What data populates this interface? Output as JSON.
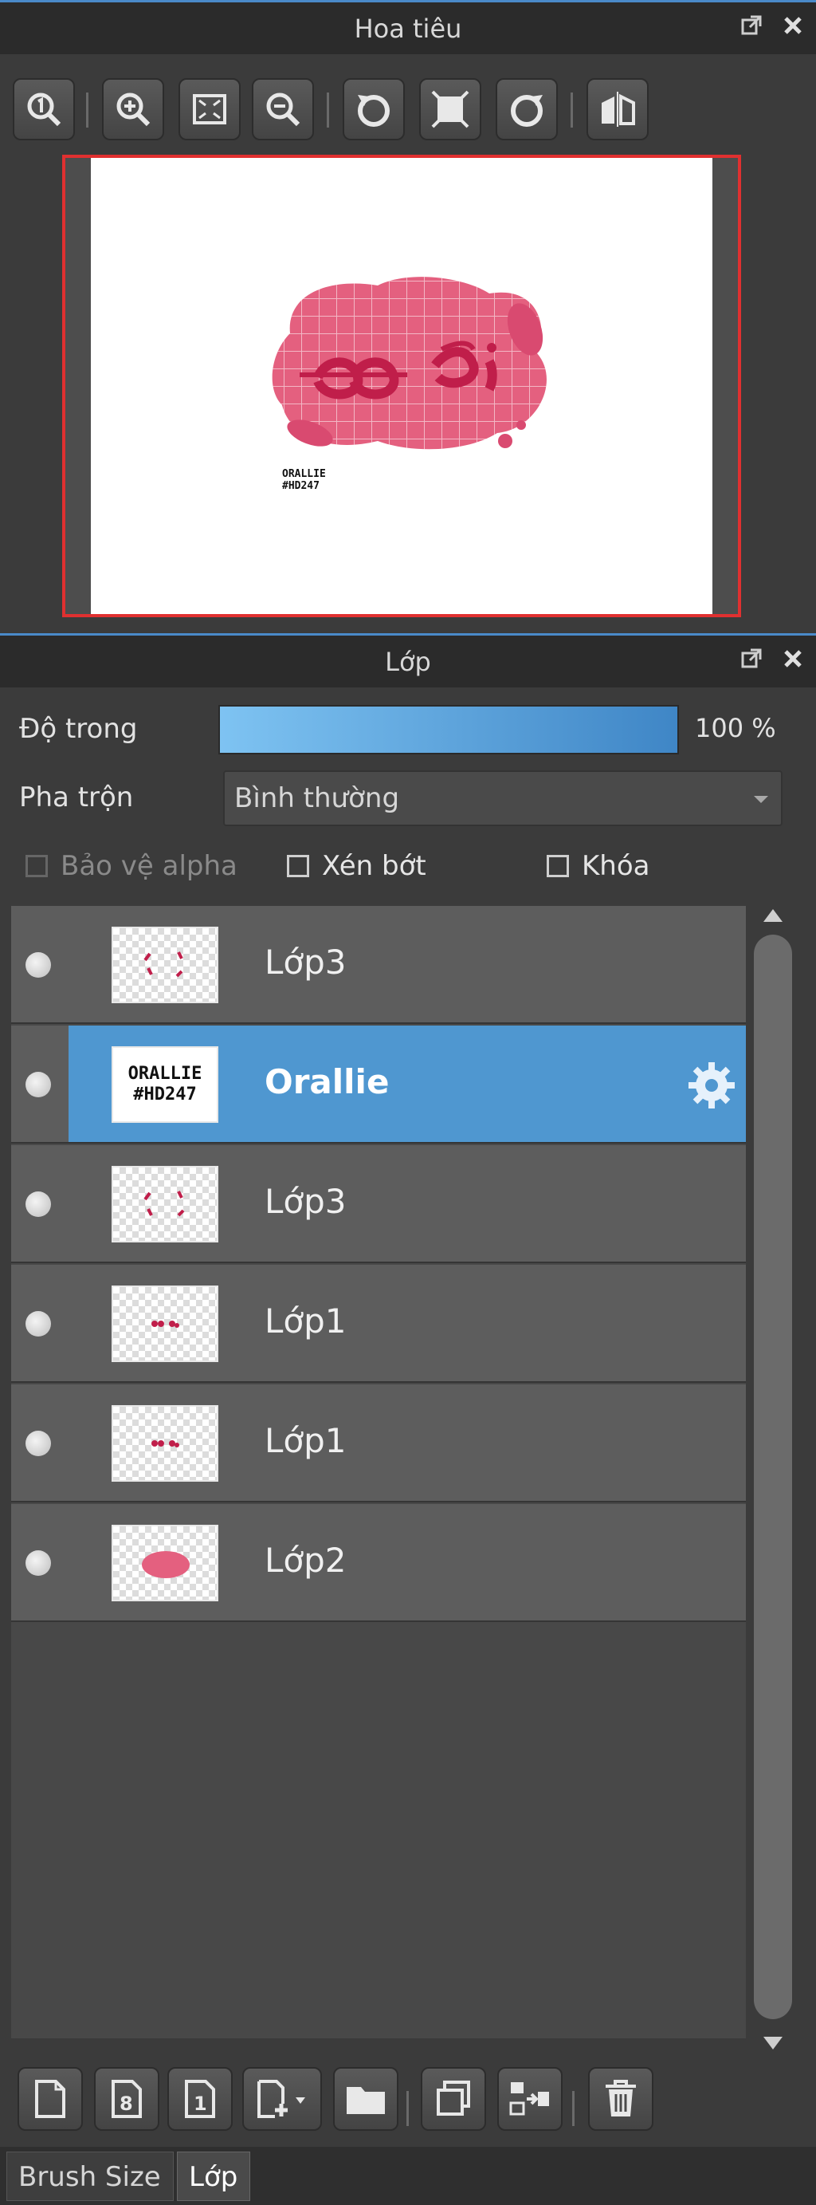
{
  "navigator": {
    "title": "Hoa tiêu",
    "canvas_text": {
      "phrase": "ĐĐ ĐI",
      "brand_top": "ORALLIE",
      "brand_bottom": "#HD247"
    }
  },
  "layers_panel": {
    "title": "Lớp",
    "opacity_label": "Độ trong",
    "opacity_value": "100 %",
    "opacity_percent": 100,
    "blend_label": "Pha trộn",
    "blend_value": "Bình thường",
    "checkboxes": {
      "alpha": "Bảo vệ alpha",
      "clip": "Xén bớt",
      "lock": "Khóa"
    },
    "layers": [
      {
        "name": "Lớp3",
        "thumb": "red-marks",
        "active": false
      },
      {
        "name": "Orallie",
        "thumb": "text",
        "thumb_text_top": "ORALLIE",
        "thumb_text_bottom": "#HD247",
        "active": true
      },
      {
        "name": "Lớp3",
        "thumb": "red-marks",
        "active": false
      },
      {
        "name": "Lớp1",
        "thumb": "small-marks",
        "active": false
      },
      {
        "name": "Lớp1",
        "thumb": "small-marks",
        "active": false
      },
      {
        "name": "Lớp2",
        "thumb": "pink-blob",
        "active": false
      }
    ]
  },
  "tabs": {
    "brush_size": "Brush Size",
    "layer": "Lớp"
  },
  "colors": {
    "accent": "#4f97d0",
    "pink": "#e4607f",
    "crimson": "#c01e4a",
    "red_frame": "#e03030"
  }
}
